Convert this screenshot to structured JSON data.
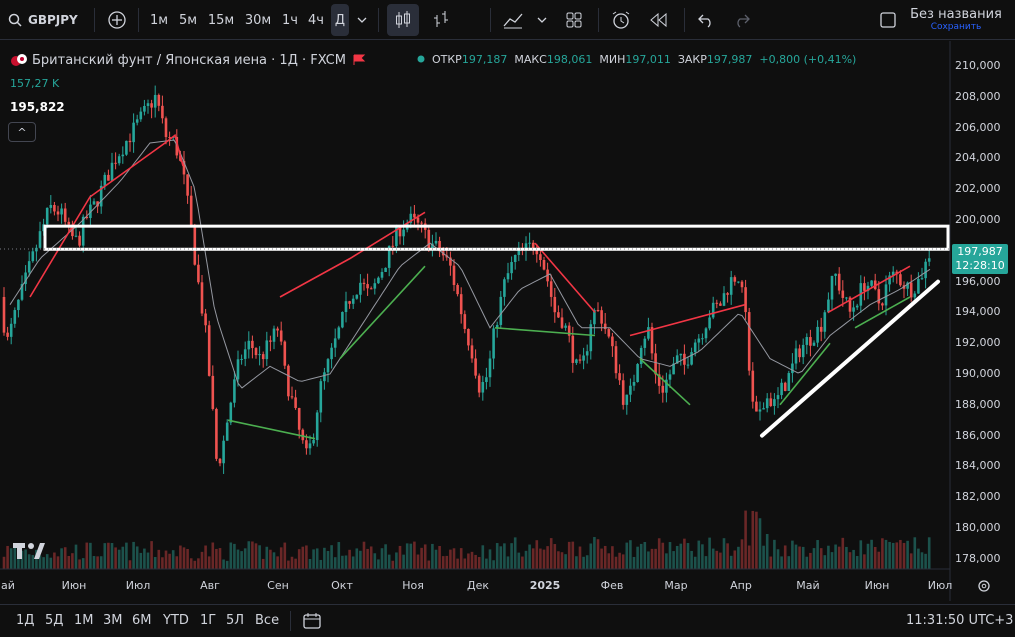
{
  "toolbar": {
    "symbol": "GBPJPY",
    "intervals": [
      "1м",
      "5м",
      "15м",
      "30м",
      "1ч",
      "4ч",
      "Д"
    ],
    "selected_interval": "Д",
    "layout_name": "Без названия",
    "save_label": "Сохранить"
  },
  "legend": {
    "title": "Британский фунт / Японская иена · 1Д · FXCM",
    "open_label": "ОТКР",
    "open": "197,187",
    "high_label": "МАКС",
    "high": "198,061",
    "low_label": "МИН",
    "low": "197,011",
    "close_label": "ЗАКР",
    "close": "197,987",
    "change": "+0,800 (+0,41%)",
    "volume": "157,27 K",
    "indicator_value": "195,822",
    "collapse_glyph": "^"
  },
  "price_scale": {
    "labels": [
      "210,000",
      "208,000",
      "206,000",
      "204,000",
      "202,000",
      "200,000",
      "198,000",
      "196,000",
      "194,000",
      "192,000",
      "190,000",
      "188,000",
      "186,000",
      "184,000",
      "182,000",
      "180,000",
      "178,000"
    ],
    "current_price": "197,987",
    "countdown": "12:28:10"
  },
  "time_scale": {
    "labels": [
      "ай",
      "Июн",
      "Июл",
      "Авг",
      "Сен",
      "Окт",
      "Ноя",
      "Дек",
      "2025",
      "Фев",
      "Мар",
      "Апр",
      "Май",
      "Июн",
      "Июл"
    ]
  },
  "bottombar": {
    "ranges": [
      "1Д",
      "5Д",
      "1М",
      "3М",
      "6М",
      "YTD",
      "1Г",
      "5Л",
      "Все"
    ],
    "clock": "11:31:50 UTC+3"
  },
  "colors": {
    "up": "#26a69a",
    "down": "#ef5350",
    "bg": "#0f0f0f"
  },
  "chart_data": {
    "type": "candlestick",
    "y_range": [
      177,
      211
    ],
    "current_price": 197.987,
    "anchors": [
      [
        0,
        195
      ],
      [
        7,
        192
      ],
      [
        18,
        194.5
      ],
      [
        30,
        197
      ],
      [
        40,
        199
      ],
      [
        50,
        200.8
      ],
      [
        60,
        200.5
      ],
      [
        70,
        199
      ],
      [
        78,
        198.5
      ],
      [
        85,
        200
      ],
      [
        95,
        201
      ],
      [
        105,
        202.5
      ],
      [
        115,
        204
      ],
      [
        125,
        205
      ],
      [
        135,
        206
      ],
      [
        145,
        207
      ],
      [
        155,
        208
      ],
      [
        160,
        207
      ],
      [
        165,
        205.5
      ],
      [
        175,
        205
      ],
      [
        183,
        203
      ],
      [
        190,
        200
      ],
      [
        198,
        196
      ],
      [
        205,
        193
      ],
      [
        212,
        188
      ],
      [
        217,
        184
      ],
      [
        222,
        185
      ],
      [
        230,
        188
      ],
      [
        240,
        191
      ],
      [
        250,
        192
      ],
      [
        260,
        191
      ],
      [
        270,
        192
      ],
      [
        278,
        193
      ],
      [
        285,
        190
      ],
      [
        293,
        188
      ],
      [
        300,
        186
      ],
      [
        307,
        184.5
      ],
      [
        313,
        186
      ],
      [
        320,
        189
      ],
      [
        330,
        191
      ],
      [
        340,
        193
      ],
      [
        350,
        195
      ],
      [
        360,
        196
      ],
      [
        370,
        195
      ],
      [
        380,
        196.5
      ],
      [
        390,
        198
      ],
      [
        400,
        199.5
      ],
      [
        410,
        200
      ],
      [
        420,
        199.5
      ],
      [
        430,
        198.5
      ],
      [
        440,
        198
      ],
      [
        450,
        197
      ],
      [
        458,
        195
      ],
      [
        465,
        193
      ],
      [
        472,
        191.5
      ],
      [
        480,
        189
      ],
      [
        488,
        190
      ],
      [
        495,
        193
      ],
      [
        505,
        196
      ],
      [
        515,
        197.5
      ],
      [
        525,
        198
      ],
      [
        535,
        198.5
      ],
      [
        540,
        198
      ],
      [
        548,
        196
      ],
      [
        555,
        194
      ],
      [
        563,
        193.5
      ],
      [
        570,
        192
      ],
      [
        578,
        190
      ],
      [
        585,
        191
      ],
      [
        592,
        194
      ],
      [
        600,
        194
      ],
      [
        610,
        192
      ],
      [
        618,
        190
      ],
      [
        625,
        188
      ],
      [
        632,
        189
      ],
      [
        640,
        192
      ],
      [
        648,
        193
      ],
      [
        655,
        190
      ],
      [
        662,
        189
      ],
      [
        670,
        190
      ],
      [
        678,
        191
      ],
      [
        685,
        190.5
      ],
      [
        692,
        192
      ],
      [
        700,
        192.5
      ],
      [
        710,
        194
      ],
      [
        720,
        194.5
      ],
      [
        730,
        196
      ],
      [
        738,
        196.5
      ],
      [
        745,
        194
      ],
      [
        750,
        190
      ],
      [
        755,
        187
      ],
      [
        760,
        187.5
      ],
      [
        768,
        188.5
      ],
      [
        775,
        188
      ],
      [
        782,
        189
      ],
      [
        790,
        190
      ],
      [
        798,
        191.5
      ],
      [
        805,
        192
      ],
      [
        812,
        192.5
      ],
      [
        820,
        193
      ],
      [
        828,
        195
      ],
      [
        835,
        196.5
      ],
      [
        843,
        195
      ],
      [
        850,
        194
      ],
      [
        858,
        195
      ],
      [
        865,
        196
      ],
      [
        872,
        195.5
      ],
      [
        880,
        194.5
      ],
      [
        888,
        196
      ],
      [
        895,
        196.5
      ],
      [
        902,
        196
      ],
      [
        910,
        195.5
      ],
      [
        918,
        196
      ],
      [
        925,
        197
      ],
      [
        930,
        198
      ]
    ],
    "ma_anchors": [
      [
        10,
        194.5
      ],
      [
        40,
        197.5
      ],
      [
        80,
        199.8
      ],
      [
        120,
        202.5
      ],
      [
        150,
        205
      ],
      [
        175,
        205.2
      ],
      [
        195,
        202
      ],
      [
        215,
        194
      ],
      [
        240,
        189
      ],
      [
        270,
        190.5
      ],
      [
        300,
        189.5
      ],
      [
        330,
        190
      ],
      [
        360,
        193
      ],
      [
        400,
        197
      ],
      [
        430,
        198.5
      ],
      [
        460,
        197
      ],
      [
        490,
        193
      ],
      [
        520,
        195.5
      ],
      [
        550,
        196.5
      ],
      [
        580,
        193
      ],
      [
        610,
        193
      ],
      [
        640,
        191
      ],
      [
        670,
        190.5
      ],
      [
        700,
        191.5
      ],
      [
        740,
        194
      ],
      [
        770,
        191
      ],
      [
        800,
        190
      ],
      [
        830,
        192.5
      ],
      [
        870,
        194.5
      ],
      [
        900,
        195.5
      ],
      [
        930,
        196.8
      ]
    ],
    "zigzag_red": [
      [
        30,
        195
      ],
      [
        90,
        201.5
      ],
      [
        165,
        205
      ],
      [
        175,
        205.5
      ],
      [
        183,
        203.5
      ]
    ],
    "zigzag_red2": [
      [
        280,
        195
      ],
      [
        350,
        197.5
      ],
      [
        425,
        200.5
      ]
    ],
    "zigzag_red3": [
      [
        535,
        198.5
      ],
      [
        595,
        194
      ]
    ],
    "zigzag_red4": [
      [
        630,
        192.5
      ],
      [
        745,
        194.5
      ]
    ],
    "zigzag_red5": [
      [
        828,
        194
      ],
      [
        910,
        197
      ]
    ],
    "zigzag_green": [
      [
        228,
        187
      ],
      [
        315,
        185.8
      ]
    ],
    "zigzag_green2": [
      [
        340,
        191
      ],
      [
        425,
        197
      ]
    ],
    "zigzag_green3": [
      [
        495,
        193
      ],
      [
        595,
        192.5
      ]
    ],
    "zigzag_green4": [
      [
        640,
        191
      ],
      [
        690,
        188
      ]
    ],
    "zigzag_green5": [
      [
        780,
        188
      ],
      [
        830,
        192
      ]
    ],
    "zigzag_green6": [
      [
        855,
        193
      ],
      [
        910,
        195
      ]
    ],
    "resistance_zone": {
      "y_top": 199.6,
      "y_bottom": 198.1,
      "x_start": 45,
      "x_end": 948
    },
    "trendline": {
      "from": [
        762,
        186
      ],
      "to": [
        938,
        196
      ]
    }
  }
}
